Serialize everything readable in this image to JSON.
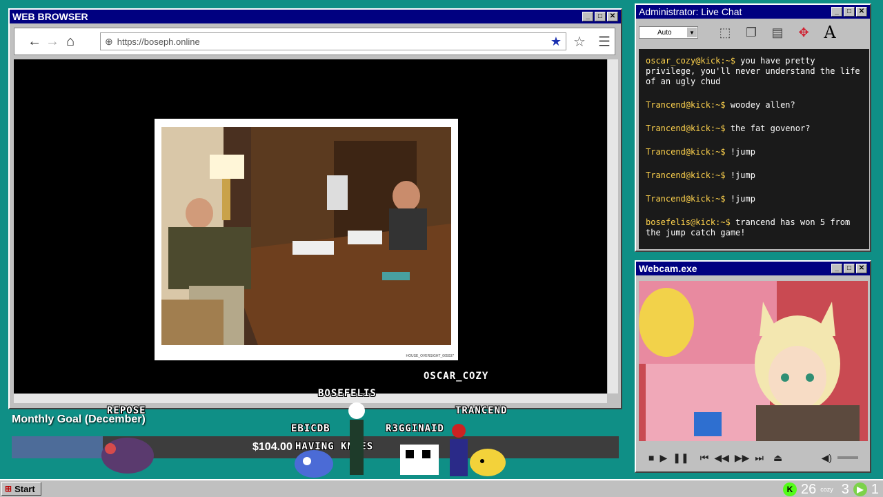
{
  "browser": {
    "title": "WEB BROWSER",
    "url": "https://boseph.online",
    "photo_caption": "HOUSE_OVERSIGHT_065037"
  },
  "chat": {
    "title": "Administrator: Live Chat",
    "font_select": "Auto",
    "messages": [
      {
        "user": "oscar_cozy@kick:~$",
        "text": "you have pretty privilege, you'll never understand the life of an ugly chud"
      },
      {
        "user": "Trancend@kick:~$",
        "text": "woodey allen?"
      },
      {
        "user": "Trancend@kick:~$",
        "text": "the fat govenor?"
      },
      {
        "user": "Trancend@kick:~$",
        "text": "!jump"
      },
      {
        "user": "Trancend@kick:~$",
        "text": "!jump"
      },
      {
        "user": "Trancend@kick:~$",
        "text": "!jump"
      },
      {
        "user": "bosefelis@kick:~$",
        "text": "trancend has won 5 from the jump catch game!"
      }
    ]
  },
  "webcam": {
    "title": "Webcam.exe"
  },
  "overlay": {
    "goal_label": "Monthly Goal (December)",
    "goal_amount": "$104.00",
    "goal_fraction": 0.15,
    "nicks": {
      "oscar": "OSCAR_COZY",
      "bosefelis": "BOSEFELIS",
      "repose": "REPOSE",
      "trancend": "TRANCEND",
      "ebicdb": "EBICDB",
      "r3gginaid": "R3GGINAID",
      "knees": "HAVING KNEES"
    }
  },
  "taskbar": {
    "start": "Start",
    "tray_k": "26",
    "tray_cozy": "cozy",
    "tray_3": "3",
    "tray_1": "1"
  },
  "colors": {
    "desktop": "#0f8f86",
    "titlebar": "#000080",
    "chat_user": "#ffd34d"
  }
}
